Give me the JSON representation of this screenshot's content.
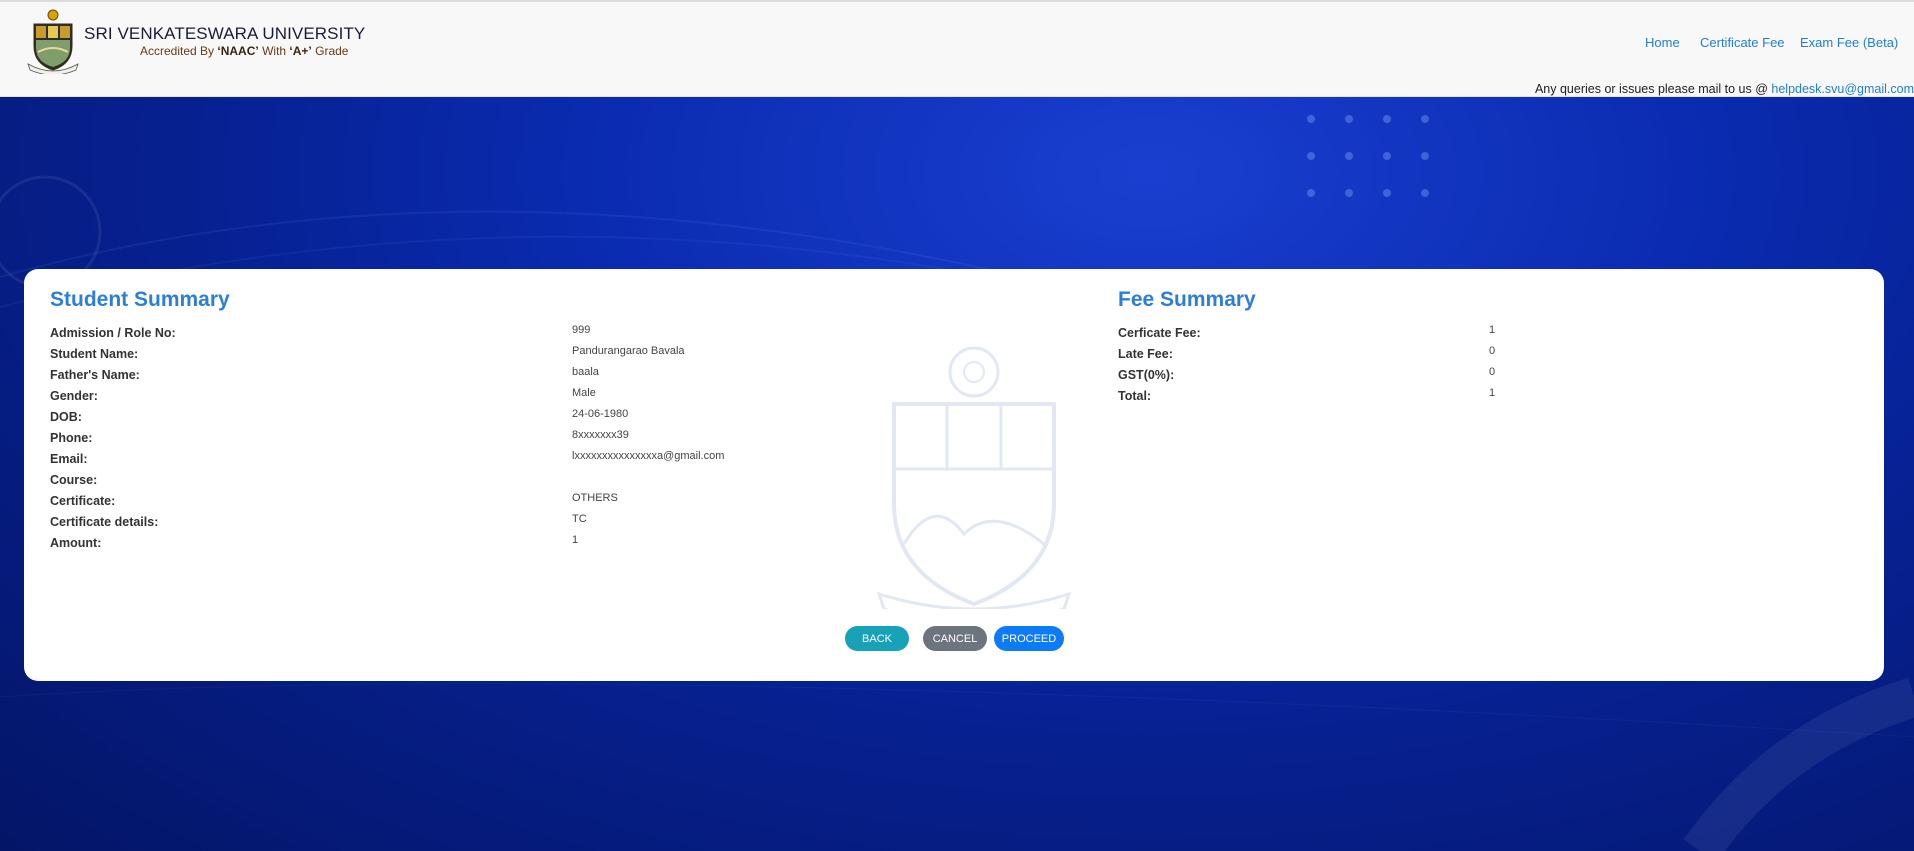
{
  "header": {
    "university_name": "SRI VENKATESWARA UNIVERSITY",
    "accreditation_prefix": "Accredited By",
    "accreditation_body": "‘NAAC’",
    "accreditation_mid": "With",
    "accreditation_grade": "‘A+’",
    "accreditation_suffix": "Grade",
    "nav": {
      "home": "Home",
      "certificate_fee": "Certificate Fee",
      "exam_fee": "Exam Fee (Beta)"
    },
    "queries_text": "Any queries or issues please mail to us @",
    "helpdesk_email": "helpdesk.svu@gmail.com"
  },
  "student_summary": {
    "title": "Student Summary",
    "rows": [
      {
        "label": "Admission / Role No:",
        "value": "999"
      },
      {
        "label": "Student Name:",
        "value": "Pandurangarao Bavala"
      },
      {
        "label": "Father's Name:",
        "value": "baala"
      },
      {
        "label": "Gender:",
        "value": "Male"
      },
      {
        "label": "DOB:",
        "value": "24-06-1980"
      },
      {
        "label": "Phone:",
        "value": "8xxxxxxx39"
      },
      {
        "label": "Email:",
        "value": "lxxxxxxxxxxxxxxxa@gmail.com"
      },
      {
        "label": "Course:",
        "value": ""
      },
      {
        "label": "Certificate:",
        "value": "OTHERS"
      },
      {
        "label": "Certificate details:",
        "value": "TC"
      },
      {
        "label": "Amount:",
        "value": "1"
      }
    ]
  },
  "fee_summary": {
    "title": "Fee Summary",
    "rows": [
      {
        "label": "Cerficate Fee:",
        "value": "1"
      },
      {
        "label": "Late Fee:",
        "value": "0"
      },
      {
        "label": "GST(0%):",
        "value": "0"
      },
      {
        "label": "Total:",
        "value": "1"
      }
    ]
  },
  "actions": {
    "back": "BACK",
    "cancel": "CANCEL",
    "proceed": "PROCEED"
  },
  "colors": {
    "accent_blue": "#2d7ed8",
    "link_blue": "#1e7fd6",
    "back_button": "#17a2b8",
    "cancel_button": "#6c757d",
    "proceed_button": "#0d7bf5",
    "background": "#061a8a"
  },
  "icons": {
    "logo": "university-crest-icon",
    "watermark": "university-crest-watermark"
  }
}
